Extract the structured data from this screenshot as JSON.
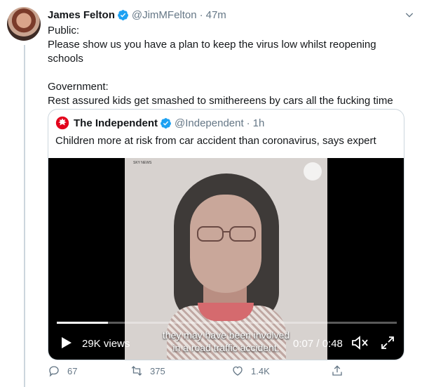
{
  "tweet": {
    "author_name": "James Felton",
    "handle": "@JimMFelton",
    "time": "47m",
    "text": "Public:\nPlease show us you have a plan to keep the virus low whilst reopening schools\n\nGovernment:\nRest assured kids get smashed to smithereens by cars all the fucking time"
  },
  "quote": {
    "author_name": "The Independent",
    "handle": "@Independent",
    "time": "1h",
    "text": "Children more at risk from car accident than coronavirus, says expert"
  },
  "video": {
    "channel_watermark": "SKY NEWS",
    "caption_line1": "they may have been involved",
    "caption_line2": "in a road traffic accident.",
    "views": "29K views",
    "timecode": "0:07 / 0:48",
    "progress_fraction": 0.15
  },
  "actions": {
    "replies": "67",
    "retweets": "375",
    "likes": "1.4K"
  },
  "colors": {
    "verified": "#1da1f2",
    "secondary_text": "#657786",
    "border": "#ccd6dd",
    "independent_red": "#e3001b"
  },
  "icons": [
    "verified-icon",
    "caret-down-icon",
    "independent-eagle-icon",
    "play-icon",
    "mute-icon",
    "fullscreen-icon",
    "reply-icon",
    "retweet-icon",
    "like-icon",
    "share-icon"
  ]
}
